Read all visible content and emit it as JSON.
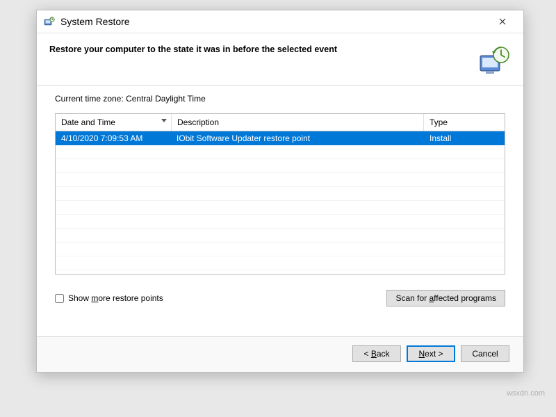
{
  "window": {
    "title": "System Restore"
  },
  "header": {
    "heading": "Restore your computer to the state it was in before the selected event"
  },
  "timezone": {
    "label": "Current time zone:",
    "value": "Central Daylight Time"
  },
  "columns": {
    "date": "Date and Time",
    "description": "Description",
    "type": "Type"
  },
  "rows": [
    {
      "date": "4/10/2020 7:09:53 AM",
      "description": "IObit Software Updater restore point",
      "type": "Install",
      "selected": true
    }
  ],
  "options": {
    "show_more_prefix": "Show ",
    "show_more_underlined": "m",
    "show_more_suffix": "ore restore points",
    "show_more_checked": false
  },
  "buttons": {
    "scan_prefix": "Scan for ",
    "scan_underlined": "a",
    "scan_suffix": "ffected programs",
    "back_prefix": "< ",
    "back_underlined": "B",
    "back_suffix": "ack",
    "next_underlined": "N",
    "next_suffix": "ext >",
    "cancel": "Cancel"
  },
  "watermark": "wsxdn.com",
  "colors": {
    "selection": "#0078d7"
  }
}
